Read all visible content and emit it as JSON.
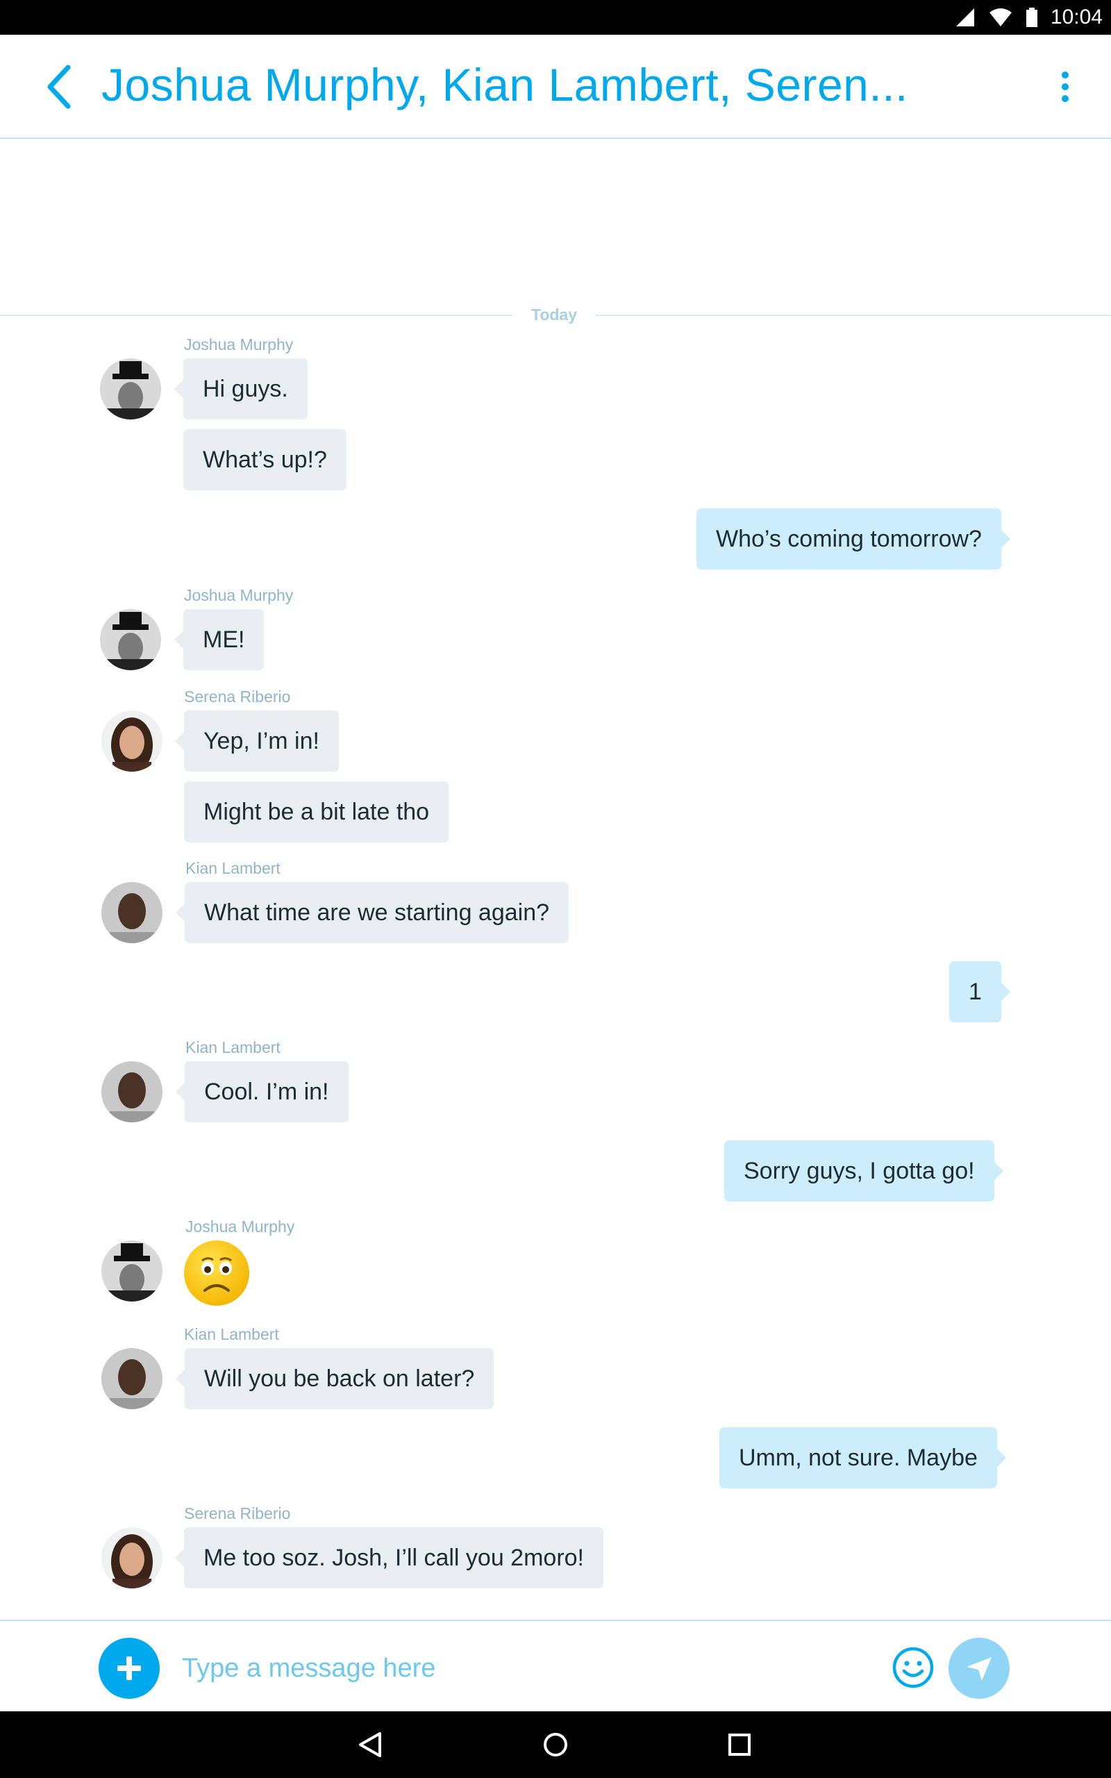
{
  "status_bar": {
    "time": "10:04",
    "icons": [
      "signal-icon",
      "wifi-icon",
      "battery-icon"
    ]
  },
  "header": {
    "title": "Joshua Murphy, Kian Lambert, Seren...",
    "back_icon": "chevron-left-icon",
    "more_icon": "more-vertical-icon"
  },
  "chat": {
    "date_divider": "Today",
    "senders": {
      "joshua": "Joshua Murphy",
      "serena": "Serena Riberio",
      "kian": "Kian Lambert"
    },
    "messages": [
      {
        "from": "joshua",
        "text": "Hi guys."
      },
      {
        "from": "joshua",
        "text": "What’s up!?"
      },
      {
        "from": "me",
        "text": "Who’s coming tomorrow?"
      },
      {
        "from": "joshua",
        "text": "ME!"
      },
      {
        "from": "serena",
        "text": "Yep, I’m in!"
      },
      {
        "from": "serena",
        "text": "Might be a bit late tho"
      },
      {
        "from": "kian",
        "text": "What time are we starting again?"
      },
      {
        "from": "me",
        "text": "1"
      },
      {
        "from": "kian",
        "text": "Cool. I’m in!"
      },
      {
        "from": "me",
        "text": "Sorry guys, I gotta go!"
      },
      {
        "from": "joshua",
        "emoji": "sad-face-emoji"
      },
      {
        "from": "kian",
        "text": "Will you be back on later?"
      },
      {
        "from": "me",
        "text": "Umm, not sure. Maybe"
      },
      {
        "from": "serena",
        "text": "Me too soz. Josh, I’ll call you 2moro!"
      }
    ]
  },
  "composer": {
    "placeholder": "Type a message here",
    "value": "",
    "icons": [
      "plus-icon",
      "smiley-icon",
      "send-icon"
    ]
  },
  "nav_bar": {
    "icons": [
      "back-triangle-icon",
      "home-circle-icon",
      "recents-square-icon"
    ]
  },
  "colors": {
    "accent": "#00a9ec",
    "incoming_bubble": "#e8eef2",
    "outgoing_bubble": "#cceefc",
    "sender_label": "#8fb5c9"
  }
}
